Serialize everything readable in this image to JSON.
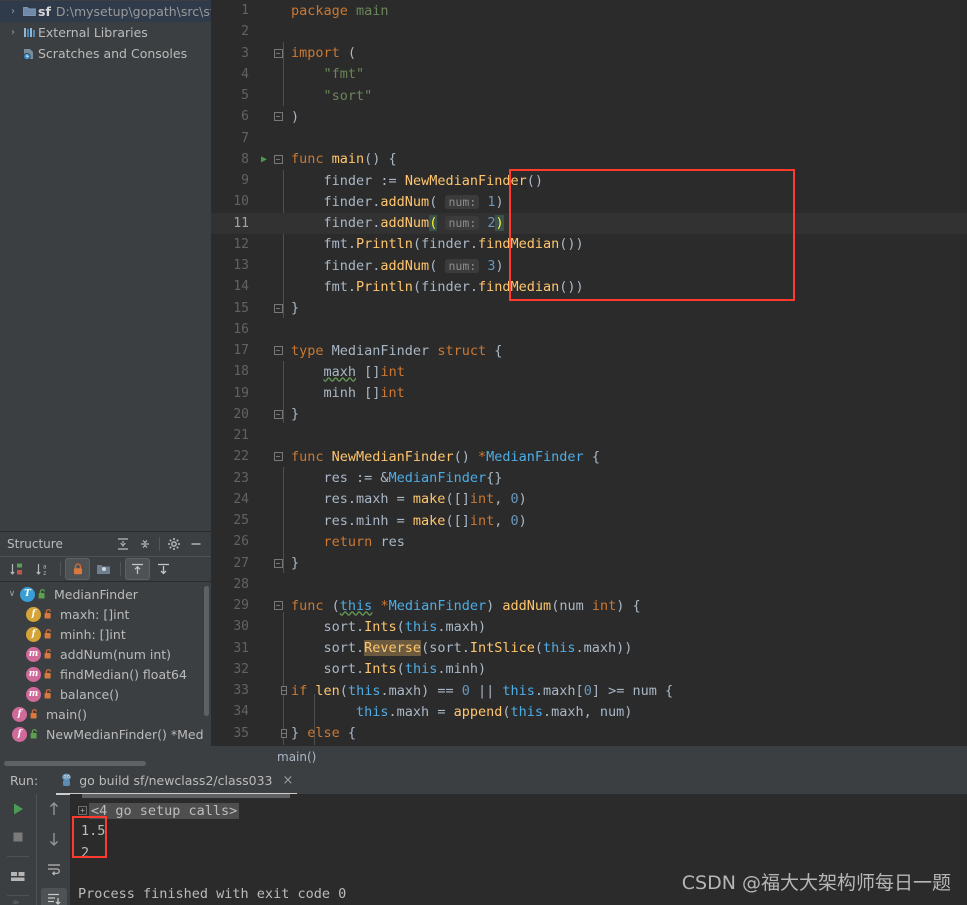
{
  "project": {
    "rows": [
      {
        "arrow": "›",
        "icon": "folder-icon",
        "name": "sf",
        "path": "D:\\mysetup\\gopath\\src\\sf",
        "selected": true
      },
      {
        "arrow": "›",
        "icon": "library-icon",
        "name": "External Libraries",
        "path": "",
        "selected": false
      },
      {
        "arrow": "",
        "icon": "scratches-icon",
        "name": "Scratches and Consoles",
        "path": "",
        "selected": false
      }
    ]
  },
  "structure": {
    "title": "Structure",
    "header_buttons": [
      {
        "name": "expand-all-icon"
      },
      {
        "name": "collapse-all-icon"
      },
      {
        "name": "gear-icon"
      },
      {
        "name": "hide-icon"
      }
    ],
    "toolbar_buttons": [
      {
        "name": "sort-by-visibility-icon",
        "active": false
      },
      {
        "name": "sort-alphabetically-icon",
        "active": false
      },
      {
        "name": "show-non-public-icon",
        "active": true
      },
      {
        "name": "group-icon",
        "active": false
      },
      {
        "name": "show-inherited-icon",
        "active": true
      },
      {
        "name": "show-imported-icon",
        "active": false
      }
    ],
    "items": [
      {
        "chevron": "∨",
        "badge": "T",
        "badge_kind": "b-t",
        "lock": "public",
        "label": "MedianFinder",
        "indent": 0
      },
      {
        "chevron": "",
        "badge": "f",
        "badge_kind": "b-f",
        "lock": "private",
        "label": "maxh: []int",
        "indent": 1
      },
      {
        "chevron": "",
        "badge": "f",
        "badge_kind": "b-f",
        "lock": "private",
        "label": "minh: []int",
        "indent": 1
      },
      {
        "chevron": "",
        "badge": "m",
        "badge_kind": "b-m",
        "lock": "private",
        "label": "addNum(num int)",
        "indent": 1
      },
      {
        "chevron": "",
        "badge": "m",
        "badge_kind": "b-m",
        "lock": "private",
        "label": "findMedian() float64",
        "indent": 1
      },
      {
        "chevron": "",
        "badge": "m",
        "badge_kind": "b-m",
        "lock": "private",
        "label": "balance()",
        "indent": 1
      },
      {
        "chevron": "",
        "badge": "f",
        "badge_kind": "b-fn",
        "lock": "private",
        "label": "main()",
        "indent": 0
      },
      {
        "chevron": "",
        "badge": "f",
        "badge_kind": "b-fn",
        "lock": "public",
        "label": "NewMedianFinder() *Med",
        "indent": 0
      }
    ]
  },
  "editor": {
    "breadcrumb": "main()",
    "current_line": 11,
    "run_marker_line": 8,
    "lines": [
      {
        "n": 1,
        "text": "package main"
      },
      {
        "n": 2,
        "text": ""
      },
      {
        "n": 3,
        "text": "import ("
      },
      {
        "n": 4,
        "text": "    \"fmt\""
      },
      {
        "n": 5,
        "text": "    \"sort\""
      },
      {
        "n": 6,
        "text": ")"
      },
      {
        "n": 7,
        "text": ""
      },
      {
        "n": 8,
        "text": "func main() {"
      },
      {
        "n": 9,
        "text": "    finder := NewMedianFinder()"
      },
      {
        "n": 10,
        "text": "    finder.addNum( num: 1)"
      },
      {
        "n": 11,
        "text": "    finder.addNum( num: 2)"
      },
      {
        "n": 12,
        "text": "    fmt.Println(finder.findMedian())"
      },
      {
        "n": 13,
        "text": "    finder.addNum( num: 3)"
      },
      {
        "n": 14,
        "text": "    fmt.Println(finder.findMedian())"
      },
      {
        "n": 15,
        "text": "}"
      },
      {
        "n": 16,
        "text": ""
      },
      {
        "n": 17,
        "text": "type MedianFinder struct {"
      },
      {
        "n": 18,
        "text": "    maxh []int"
      },
      {
        "n": 19,
        "text": "    minh []int"
      },
      {
        "n": 20,
        "text": "}"
      },
      {
        "n": 21,
        "text": ""
      },
      {
        "n": 22,
        "text": "func NewMedianFinder() *MedianFinder {"
      },
      {
        "n": 23,
        "text": "    res := &MedianFinder{}"
      },
      {
        "n": 24,
        "text": "    res.maxh = make([]int, 0)"
      },
      {
        "n": 25,
        "text": "    res.minh = make([]int, 0)"
      },
      {
        "n": 26,
        "text": "    return res"
      },
      {
        "n": 27,
        "text": "}"
      },
      {
        "n": 28,
        "text": ""
      },
      {
        "n": 29,
        "text": "func (this *MedianFinder) addNum(num int) {"
      },
      {
        "n": 30,
        "text": "    sort.Ints(this.maxh)"
      },
      {
        "n": 31,
        "text": "    sort.Reverse(sort.IntSlice(this.maxh))"
      },
      {
        "n": 32,
        "text": "    sort.Ints(this.minh)"
      },
      {
        "n": 33,
        "text": "    if len(this.maxh) == 0 || this.maxh[0] >= num {"
      },
      {
        "n": 34,
        "text": "        this.maxh = append(this.maxh, num)"
      },
      {
        "n": 35,
        "text": "    } else {"
      }
    ],
    "parameter_hint_label": "num:",
    "selected_word": "Reverse"
  },
  "run": {
    "label": "Run:",
    "tab_title": "go build sf/newclass2/class033",
    "tab_icon": "go-run-icon",
    "close_label": "×",
    "gutter_left": [
      {
        "name": "rerun-icon",
        "active": false
      },
      {
        "name": "stop-icon",
        "active": false
      },
      {
        "name": "layout-icon",
        "active": false
      }
    ],
    "gutter_right": [
      {
        "name": "up-arrow-icon",
        "active": false
      },
      {
        "name": "down-arrow-icon",
        "active": false
      },
      {
        "name": "soft-wrap-icon",
        "active": false
      },
      {
        "name": "scroll-to-end-icon",
        "active": true
      }
    ],
    "console_lines": [
      {
        "text": "<4 go setup calls>",
        "kind": "folded"
      },
      {
        "text": "1.5",
        "kind": "output"
      },
      {
        "text": "2",
        "kind": "output"
      },
      {
        "text": "",
        "kind": "blank"
      },
      {
        "text": "Process finished with exit code 0",
        "kind": "status"
      }
    ]
  },
  "watermark": "CSDN @福大大架构师每日一题",
  "colors": {
    "editor_bg": "#2b2b2b",
    "panel_bg": "#3c3f41",
    "keyword": "#cc7832",
    "string": "#6a8759",
    "function": "#ffc66d",
    "number": "#6897bb",
    "identifier": "#a9b7c6",
    "annotation_red": "#ff3b30",
    "selection_blue": "#2f3a4a"
  }
}
